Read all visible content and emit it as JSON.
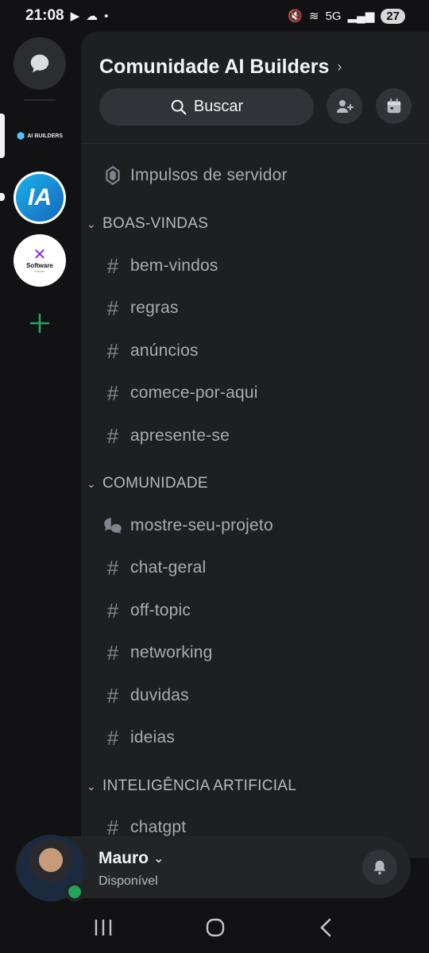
{
  "status_bar": {
    "time": "21:08",
    "battery": "27",
    "network": "5G"
  },
  "rail": {
    "servers": [
      {
        "name": "AI BUILDERS",
        "logo_text": "AI"
      },
      {
        "name": "IA",
        "logo_text": "IA"
      },
      {
        "name": "Software",
        "logo_text": "Software",
        "sub_text": "Hacker"
      }
    ]
  },
  "guild": {
    "title": "Comunidade AI Builders",
    "search_label": "Buscar"
  },
  "channels": {
    "boost": "Impulsos de servidor",
    "categories": [
      {
        "name": "BOAS-VINDAS",
        "channels": [
          "bem-vindos",
          "regras",
          "anúncios",
          "comece-por-aqui",
          "apresente-se"
        ]
      },
      {
        "name": "COMUNIDADE",
        "channels": [
          "mostre-seu-projeto",
          "chat-geral",
          "off-topic",
          "networking",
          "duvidas",
          "ideias"
        ]
      },
      {
        "name": "INTELIGÊNCIA ARTIFICIAL",
        "channels": [
          "chatgpt"
        ]
      }
    ]
  },
  "user": {
    "name": "Mauro",
    "status": "Disponível"
  },
  "colors": {
    "background": "#121214",
    "panel": "#1e1f22",
    "online": "#23a559",
    "accent_add": "#23a559"
  }
}
